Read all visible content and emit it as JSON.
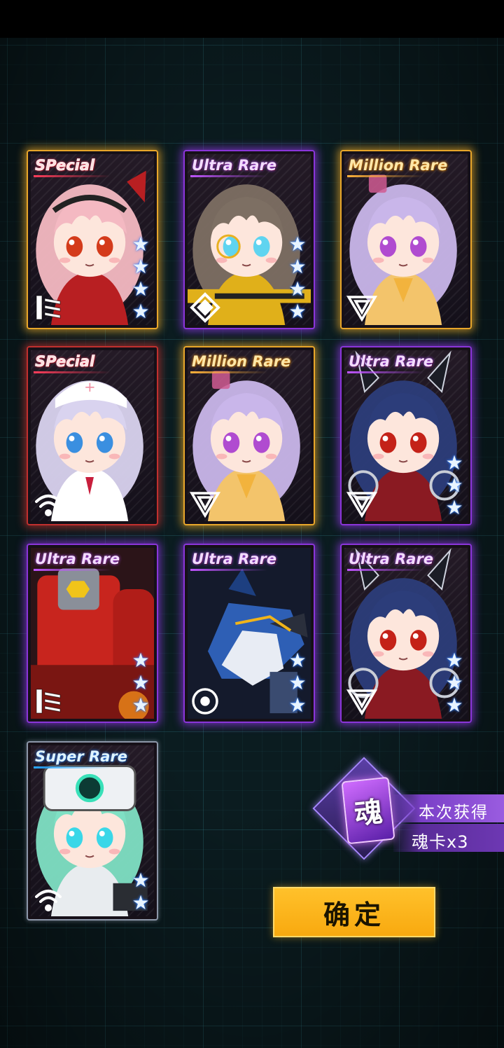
{
  "cards": [
    {
      "rarity": "SPecial",
      "rarity_style": "special",
      "frame": "gold",
      "stars": 4,
      "class_icon": "flag-stripes-icon",
      "portrait": "pink-hair-girl",
      "hair": "#f4b9c2",
      "accent": "#b81f22",
      "eyes": "#d43b1b"
    },
    {
      "rarity": "Ultra Rare",
      "rarity_style": "ultra",
      "frame": "purple",
      "stars": 4,
      "class_icon": "diamond-target-icon",
      "portrait": "gunner-girl",
      "hair": "#7d6f63",
      "accent": "#e0b01a",
      "eyes": "#5fd4f0"
    },
    {
      "rarity": "Million Rare",
      "rarity_style": "million",
      "frame": "gold",
      "stars": 0,
      "class_icon": "inverted-triangle-icon",
      "portrait": "lavender-uniform-girl",
      "hair": "#c9b6ea",
      "accent": "#f3c46b",
      "eyes": "#b04bd0"
    },
    {
      "rarity": "SPecial",
      "rarity_style": "special",
      "frame": "red",
      "stars": 0,
      "class_icon": "signal-wifi-icon",
      "portrait": "nurse-girl",
      "hair": "#d9d3ef",
      "accent": "#ffffff",
      "eyes": "#3a8fe0"
    },
    {
      "rarity": "Million Rare",
      "rarity_style": "million",
      "frame": "gold",
      "stars": 0,
      "class_icon": "inverted-triangle-icon",
      "portrait": "lavender-uniform-girl",
      "hair": "#c9b6ea",
      "accent": "#f3c46b",
      "eyes": "#b04bd0"
    },
    {
      "rarity": "Ultra Rare",
      "rarity_style": "ultra",
      "frame": "purple",
      "stars": 3,
      "class_icon": "inverted-triangle-icon",
      "portrait": "bunny-mech-girl",
      "hair": "#2c3d7a",
      "accent": "#8a1a22",
      "eyes": "#c42218"
    },
    {
      "rarity": "Ultra Rare",
      "rarity_style": "ultra",
      "frame": "purple",
      "stars": 3,
      "class_icon": "flag-stripes-icon",
      "portrait": "red-mech",
      "hair": "#c8251e",
      "accent": "#f0c41a",
      "eyes": "#f0c41a"
    },
    {
      "rarity": "Ultra Rare",
      "rarity_style": "ultra",
      "frame": "purple",
      "stars": 3,
      "class_icon": "ring-core-icon",
      "portrait": "blue-beast-mech",
      "hair": "#2e5fb5",
      "accent": "#e8ecf4",
      "eyes": "#f0b41a"
    },
    {
      "rarity": "Ultra Rare",
      "rarity_style": "ultra",
      "frame": "purple",
      "stars": 3,
      "class_icon": "inverted-triangle-icon",
      "portrait": "bunny-mech-girl",
      "hair": "#2c3d7a",
      "accent": "#8a1a22",
      "eyes": "#c42218"
    },
    {
      "rarity": "Super Rare",
      "rarity_style": "super",
      "frame": "gray",
      "stars": 2,
      "class_icon": "signal-wifi-icon",
      "portrait": "mint-helmet-girl",
      "hair": "#7fe0c4",
      "accent": "#e8ecef",
      "eyes": "#3ad7e8"
    }
  ],
  "reward": {
    "title": "本次获得",
    "soul_glyph": "魂",
    "item_text": "魂卡x3",
    "icon": "soul-card-icon"
  },
  "confirm_label": "确定"
}
